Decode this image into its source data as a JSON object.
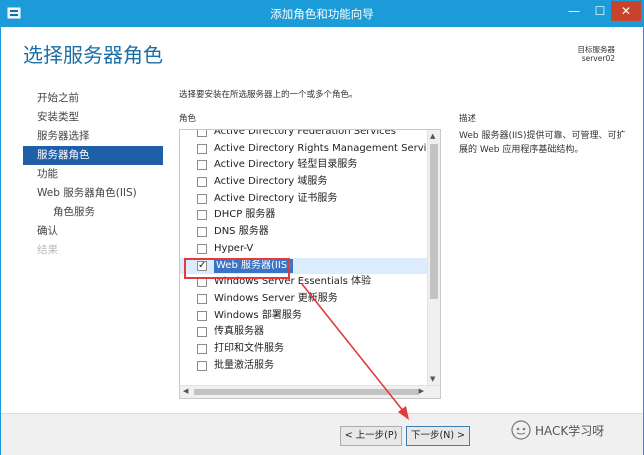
{
  "window": {
    "title": "添加角色和功能向导",
    "controls": {
      "minimize": "—",
      "maximize": "☐",
      "close": "✕"
    }
  },
  "header": {
    "page_title": "选择服务器角色",
    "target_label": "目标服务器",
    "target_server": "server02"
  },
  "nav": {
    "items": [
      {
        "label": "开始之前"
      },
      {
        "label": "安装类型"
      },
      {
        "label": "服务器选择"
      },
      {
        "label": "服务器角色"
      },
      {
        "label": "功能"
      },
      {
        "label": "Web 服务器角色(IIS)"
      },
      {
        "label": "角色服务"
      },
      {
        "label": "确认"
      },
      {
        "label": "结果"
      }
    ]
  },
  "main": {
    "instruction": "选择要安装在所选服务器上的一个或多个角色。",
    "roles_header": "角色",
    "roles": [
      {
        "label": "Active Directory Federation Services",
        "checked": false
      },
      {
        "label": "Active Directory Rights Management Services",
        "checked": false
      },
      {
        "label": "Active Directory 轻型目录服务",
        "checked": false
      },
      {
        "label": "Active Directory 域服务",
        "checked": false
      },
      {
        "label": "Active Directory 证书服务",
        "checked": false
      },
      {
        "label": "DHCP 服务器",
        "checked": false
      },
      {
        "label": "DNS 服务器",
        "checked": false
      },
      {
        "label": "Hyper-V",
        "checked": false
      },
      {
        "label": "Web 服务器(IIS)",
        "checked": true
      },
      {
        "label": "Windows Server Essentials 体验",
        "checked": false
      },
      {
        "label": "Windows Server 更新服务",
        "checked": false
      },
      {
        "label": "Windows 部署服务",
        "checked": false
      },
      {
        "label": "传真服务器",
        "checked": false
      },
      {
        "label": "打印和文件服务",
        "checked": false
      },
      {
        "label": "批量激活服务",
        "checked": false
      }
    ],
    "description_header": "描述",
    "description_text": "Web 服务器(IIS)提供可靠、可管理、可扩展的 Web 应用程序基础结构。"
  },
  "footer": {
    "prev_label": "< 上一步(P)",
    "next_label": "下一步(N) >"
  },
  "watermark": {
    "text": "HACK学习呀"
  },
  "colors": {
    "titlebar": "#1b9bd8",
    "nav_active": "#1f5fa8",
    "page_title": "#1b6fa6",
    "annotation_red": "#e23b3b"
  }
}
